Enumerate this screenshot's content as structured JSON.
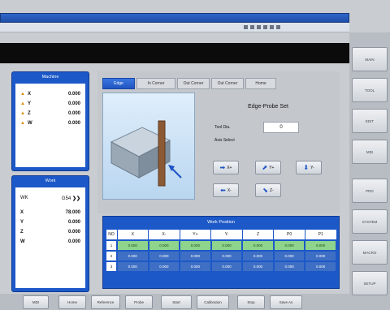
{
  "titlebar": {
    "cells": [
      "",
      "",
      "",
      "",
      "",
      ""
    ]
  },
  "right_buttons": [
    "MAIN",
    "TOOL",
    "EDIT",
    "MDI",
    "PRG",
    "SYSTEM",
    "MACRO",
    "SETUP"
  ],
  "machine": {
    "title": "Machine",
    "rows": [
      {
        "axis": "X",
        "value": "0.000"
      },
      {
        "axis": "Y",
        "value": "0.000"
      },
      {
        "axis": "Z",
        "value": "0.000"
      },
      {
        "axis": "W",
        "value": "0.000"
      }
    ]
  },
  "work": {
    "title": "Work",
    "header_left": "WK",
    "header_right": "G54",
    "rows": [
      {
        "axis": "X",
        "value": "78.000"
      },
      {
        "axis": "Y",
        "value": "0.000"
      },
      {
        "axis": "Z",
        "value": "0.000"
      },
      {
        "axis": "W",
        "value": "0.000"
      }
    ]
  },
  "tabs": [
    "Edge",
    "In Corner",
    "Out Corner",
    "Out Corner",
    "Home"
  ],
  "edge": {
    "title": "Edge-Probe Set",
    "tool_label": "Tool Dia.",
    "tool_value": "0",
    "axis_label": "Axis Select",
    "buttons": [
      "X+",
      "Y+",
      "Y-",
      "X-",
      "Z-"
    ]
  },
  "work_position": {
    "title": "Work Position",
    "headers": [
      "NO",
      "X",
      "X-",
      "Y+",
      "Y-",
      "Z",
      "P0",
      "P1"
    ],
    "rows": [
      {
        "no": "1",
        "cells": [
          "0.000",
          "0.000",
          "0.000",
          "0.000",
          "0.000",
          "0.000",
          "0.000"
        ]
      },
      {
        "no": "2",
        "cells": [
          "0.000",
          "0.000",
          "0.000",
          "0.000",
          "0.000",
          "0.000",
          "0.000"
        ]
      },
      {
        "no": "3",
        "cells": [
          "0.000",
          "0.000",
          "0.000",
          "0.000",
          "0.000",
          "0.000",
          "0.000"
        ]
      }
    ]
  },
  "bottom_buttons": [
    "MDI",
    "Home",
    "Reference",
    "Probe",
    "Start",
    "Calibration",
    "Stop",
    "Save As"
  ],
  "colors": {
    "panel_blue": "#1c58c7",
    "row_green": "#8fd48c",
    "row_blue": "#3e6fc4"
  }
}
